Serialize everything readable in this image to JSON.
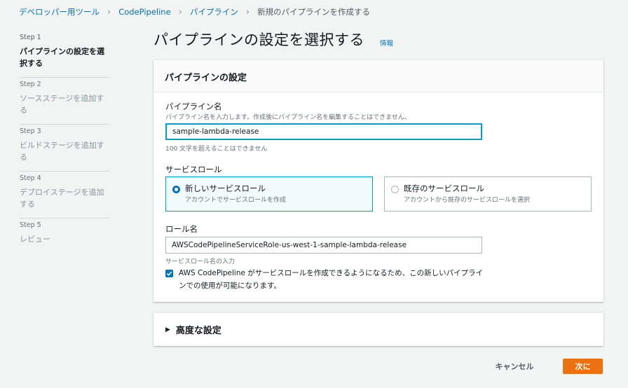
{
  "breadcrumb": {
    "items": [
      "デベロッパー用ツール",
      "CodePipeline",
      "パイプライン"
    ],
    "current": "新規のパイプラインを作成する"
  },
  "steps": [
    {
      "num": "Step 1",
      "label": "パイプラインの設定を選択する",
      "active": true
    },
    {
      "num": "Step 2",
      "label": "ソースステージを追加する",
      "active": false
    },
    {
      "num": "Step 3",
      "label": "ビルドステージを追加する",
      "active": false
    },
    {
      "num": "Step 4",
      "label": "デプロイステージを追加する",
      "active": false
    },
    {
      "num": "Step 5",
      "label": "レビュー",
      "active": false
    }
  ],
  "page": {
    "title": "パイプラインの設定を選択する",
    "info": "情報"
  },
  "panel": {
    "header": "パイプラインの設定",
    "pipeline_name": {
      "label": "パイプライン名",
      "description": "パイプライン名を入力します。作成後にパイプライン名を編集することはできません。",
      "value": "sample-lambda-release",
      "hint": "100 文字を超えることはできません"
    },
    "service_role": {
      "label": "サービスロール",
      "options": [
        {
          "title": "新しいサービスロール",
          "desc": "アカウントでサービスロールを作成",
          "selected": true
        },
        {
          "title": "既存のサービスロール",
          "desc": "アカウントから既存のサービスロールを選択",
          "selected": false
        }
      ]
    },
    "role_name": {
      "label": "ロール名",
      "value": "AWSCodePipelineServiceRole-us-west-1-sample-lambda-release",
      "hint": "サービスロール名の入力"
    },
    "checkbox": {
      "checked": true,
      "label": "AWS CodePipeline がサービスロールを作成できるようになるため、この新しいパイプラインでの使用が可能になります。"
    }
  },
  "advanced": {
    "label": "高度な設定"
  },
  "footer": {
    "cancel": "キャンセル",
    "next": "次に"
  },
  "colors": {
    "link": "#0073bb",
    "primary_button": "#ec7211",
    "focus_border": "#00a1c9"
  }
}
